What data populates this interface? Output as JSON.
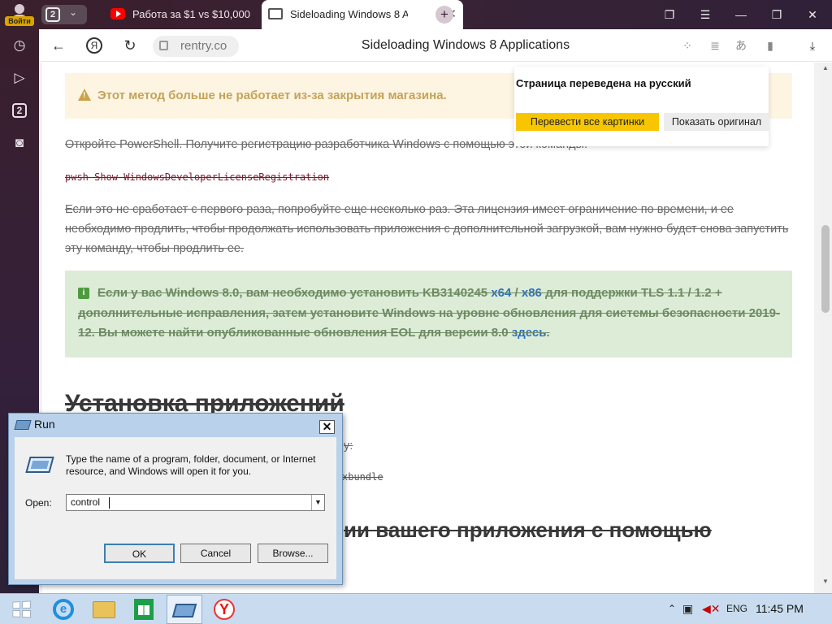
{
  "sidebar": {
    "login_label": "Войти",
    "tabs_count": "2"
  },
  "tabs": [
    {
      "title": "Работа за $1 vs $10,000,000",
      "icon": "youtube-icon"
    },
    {
      "title": "Sideloading Windows 8 Applications",
      "icon": "rentry-icon",
      "close": "✕"
    }
  ],
  "tab_counter": "2",
  "new_tab": "+",
  "toolbar": {
    "domain": "rentry.co",
    "title": "Sideloading Windows 8 Applications",
    "yandex_letter": "Я"
  },
  "translate_popup": {
    "title": "Страница переведена на русский",
    "translate_images": "Перевести все картинки",
    "show_original": "Показать оригинал"
  },
  "article": {
    "warning": "Этот метод больше не работает из-за закрытия магазина.",
    "para1": "Откройте PowerShell. Получите регистрацию разработчика Windows с помощью этой команды:",
    "code1": "pwsh Show-WindowsDeveloperLicenseRegistration",
    "para2": "Если это не сработает с первого раза, попробуйте еще несколько раз. Эта лицензия имеет ограничение по времени, и ее необходимо продлить, чтобы продолжать использовать приложения с дополнительной загрузкой, вам нужно будет снова запустить эту команду, чтобы продлить ее.",
    "info_text_1": "Если у вас Windows 8.0, вам необходимо установить KB3140245 ",
    "info_link_x64": "x64",
    "info_sep": " / ",
    "info_link_x86": "x86",
    "info_text_2": " для поддержки TLS 1.1 / 1.2 + дополнительные исправления, затем установите Windows на уровне обновления для системы безопасности 2019-12. Вы можете найти опубликованные обновления EOL для версии 8.0 ",
    "info_link_here": "здесь",
    "info_text_3": ".",
    "heading1": "Установка приложений",
    "frag1": "у:",
    "frag2": "xbundle",
    "heading2_frag": "ии вашего приложения с помощью"
  },
  "run_dialog": {
    "title": "Run",
    "close": "✕",
    "description": "Type the name of a program, folder, document, or Internet resource, and Windows will open it for you.",
    "open_label": "Open:",
    "open_value": "control",
    "ok": "OK",
    "cancel": "Cancel",
    "browse": "Browse..."
  },
  "taskbar": {
    "language": "ENG",
    "time": "11:45 PM"
  }
}
